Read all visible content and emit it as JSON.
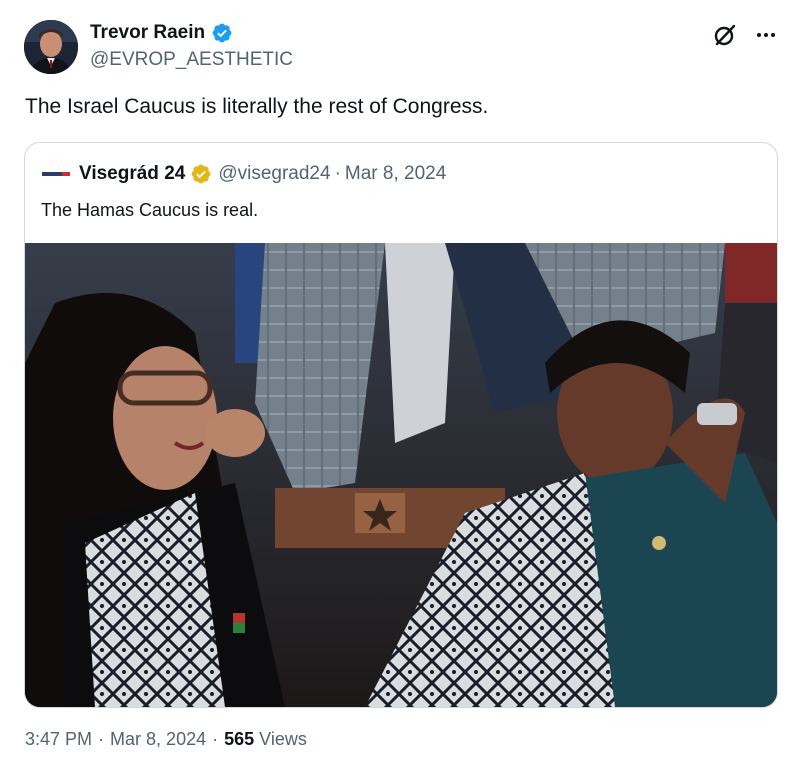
{
  "tweet": {
    "author_name": "Trevor Raein",
    "author_handle": "@EVROP_AESTHETIC",
    "text": "The Israel Caucus is literally the rest of Congress.",
    "time": "3:47 PM",
    "date": "Mar 8, 2024",
    "separator": "·",
    "views_count": "565",
    "views_label": "Views"
  },
  "quoted": {
    "author_name": "Visegrád 24",
    "author_handle": "@visegrad24",
    "separator": "·",
    "date": "Mar 8, 2024",
    "text": "The Hamas Caucus is real.",
    "logo_text": "VISEGRAD24"
  },
  "icons": {
    "verified": "verified-badge-icon",
    "quoted_verified": "gold-verified-badge-icon",
    "grok": "grok-icon",
    "more": "more-horizontal-icon"
  },
  "colors": {
    "verified_blue": "#1d9bf0",
    "verified_gold": "#e2b719",
    "secondary_text": "#536471",
    "border": "#cfd9de"
  }
}
